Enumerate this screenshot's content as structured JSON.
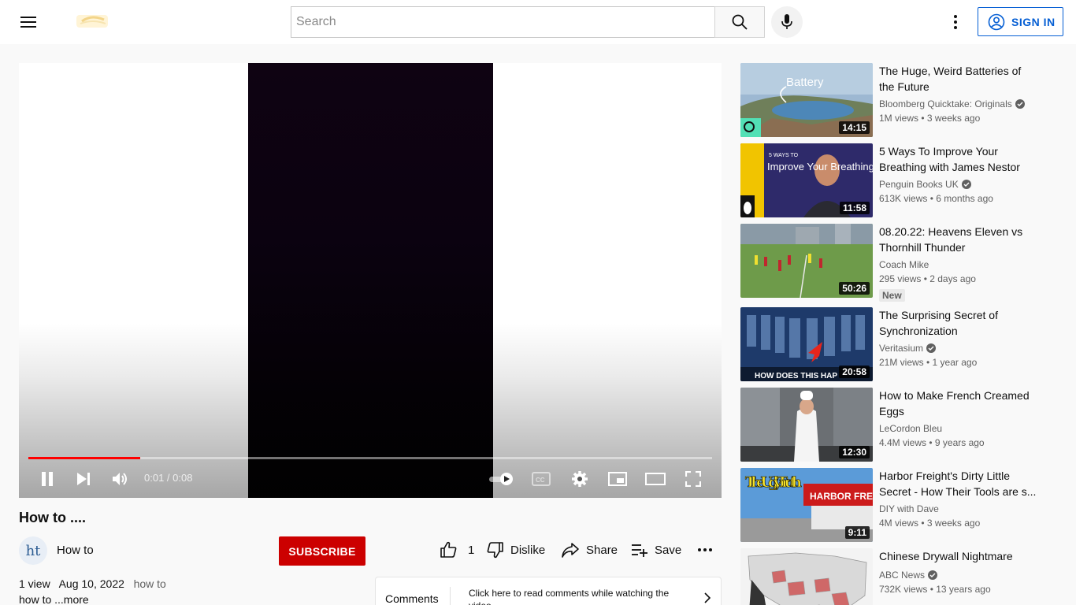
{
  "header": {
    "search_placeholder": "Search",
    "signin_label": "SIGN IN"
  },
  "player": {
    "time_current": "0:01",
    "time_total": "0:08",
    "time_display": "0:01 / 0:08",
    "progress_fraction": 0.164,
    "progress_color": "#ff0000"
  },
  "video": {
    "title": "How to ....",
    "channel_initials": "ht",
    "channel_name": "How to",
    "subscribe_label": "SUBSCRIBE",
    "like_count": "1",
    "dislike_label": "Dislike",
    "share_label": "Share",
    "save_label": "Save",
    "views": "1 view",
    "date": "Aug 10, 2022",
    "description_line1": "how to",
    "description_line2": "how to",
    "more_label": "...more"
  },
  "comments": {
    "label": "Comments",
    "hint": "Click here to read comments while watching the video."
  },
  "recommendations": [
    {
      "title": "The Huge, Weird Batteries of the Future",
      "channel": "Bloomberg Quicktake: Originals",
      "verified": true,
      "meta": "1M views • 3 weeks ago",
      "duration": "14:15",
      "thumb_text": "Battery"
    },
    {
      "title": "5 Ways To Improve Your Breathing with James Nestor",
      "channel": "Penguin Books UK",
      "verified": true,
      "meta": "613K views • 6 months ago",
      "duration": "11:58",
      "thumb_text": "Improve Your Breathing",
      "thumb_small": "5 WAYS TO"
    },
    {
      "title": "08.20.22: Heavens Eleven vs Thornhill Thunder",
      "channel": "Coach Mike",
      "verified": false,
      "meta": "295 views • 2 days ago",
      "duration": "50:26",
      "badge": "New"
    },
    {
      "title": "The Surprising Secret of Synchronization",
      "channel": "Veritasium",
      "verified": true,
      "meta": "21M views • 1 year ago",
      "duration": "20:58",
      "thumb_text": "HOW DOES THIS HAP"
    },
    {
      "title": "How to Make French Creamed Eggs",
      "channel": "LeCordon Bleu",
      "verified": false,
      "meta": "4.4M views • 9 years ago",
      "duration": "12:30"
    },
    {
      "title": "Harbor Freight's Dirty Little Secret - How Their Tools are s...",
      "channel": "DIY with Dave",
      "verified": false,
      "meta": "4M views • 3 weeks ago",
      "duration": "9:11",
      "thumb_text": "The Ugly Truth",
      "thumb_sign": "HARBOR FREIGHT"
    },
    {
      "title": "Chinese Drywall Nightmare",
      "channel": "ABC News",
      "verified": true,
      "meta": "732K views • 13 years ago",
      "duration": ""
    }
  ]
}
